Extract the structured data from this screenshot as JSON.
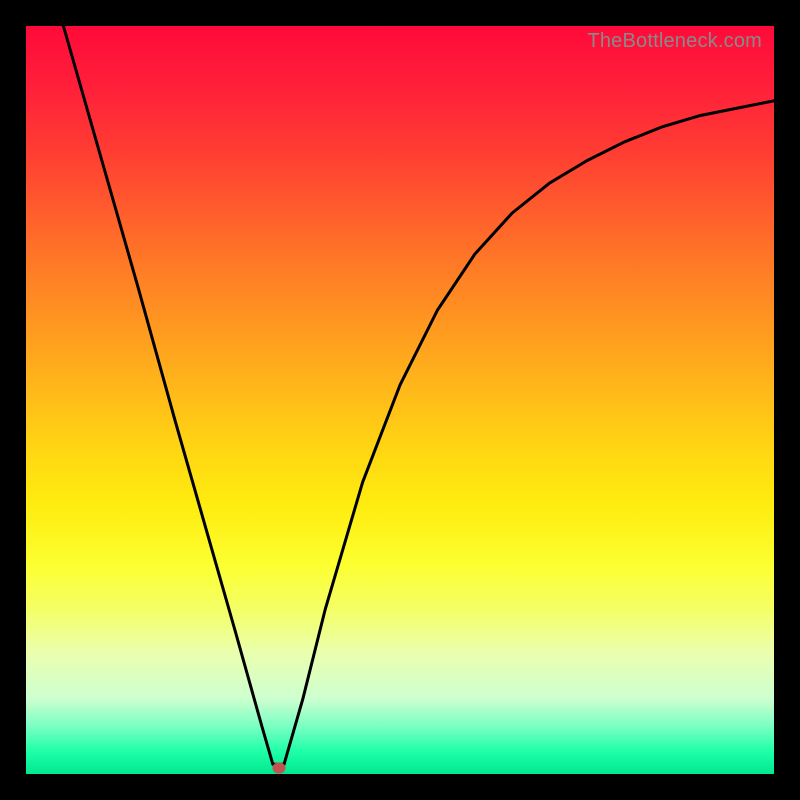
{
  "watermark": "TheBottleneck.com",
  "chart_data": {
    "type": "line",
    "title": "",
    "xlabel": "",
    "ylabel": "",
    "xlim": [
      0,
      100
    ],
    "ylim": [
      0,
      100
    ],
    "grid": false,
    "legend": false,
    "series": [
      {
        "name": "curve",
        "color": "#000000",
        "x": [
          5,
          10,
          15,
          20,
          24,
          28,
          31.5,
          33,
          34.5,
          37,
          40,
          45,
          50,
          55,
          60,
          65,
          70,
          75,
          80,
          85,
          90,
          95,
          100
        ],
        "y": [
          100,
          82.5,
          65,
          47,
          33,
          19,
          6.5,
          1.3,
          1.3,
          10,
          22,
          39,
          52,
          62,
          69.5,
          75,
          79,
          82,
          84.5,
          86.5,
          88,
          89,
          90
        ]
      }
    ],
    "marker": {
      "name": "minimum-point",
      "x": 33.8,
      "y": 0.8,
      "color": "#c4524f"
    },
    "background_gradient": {
      "top": "#ff0a3a",
      "mid": "#ffd413",
      "bottom": "#00e88f"
    }
  }
}
